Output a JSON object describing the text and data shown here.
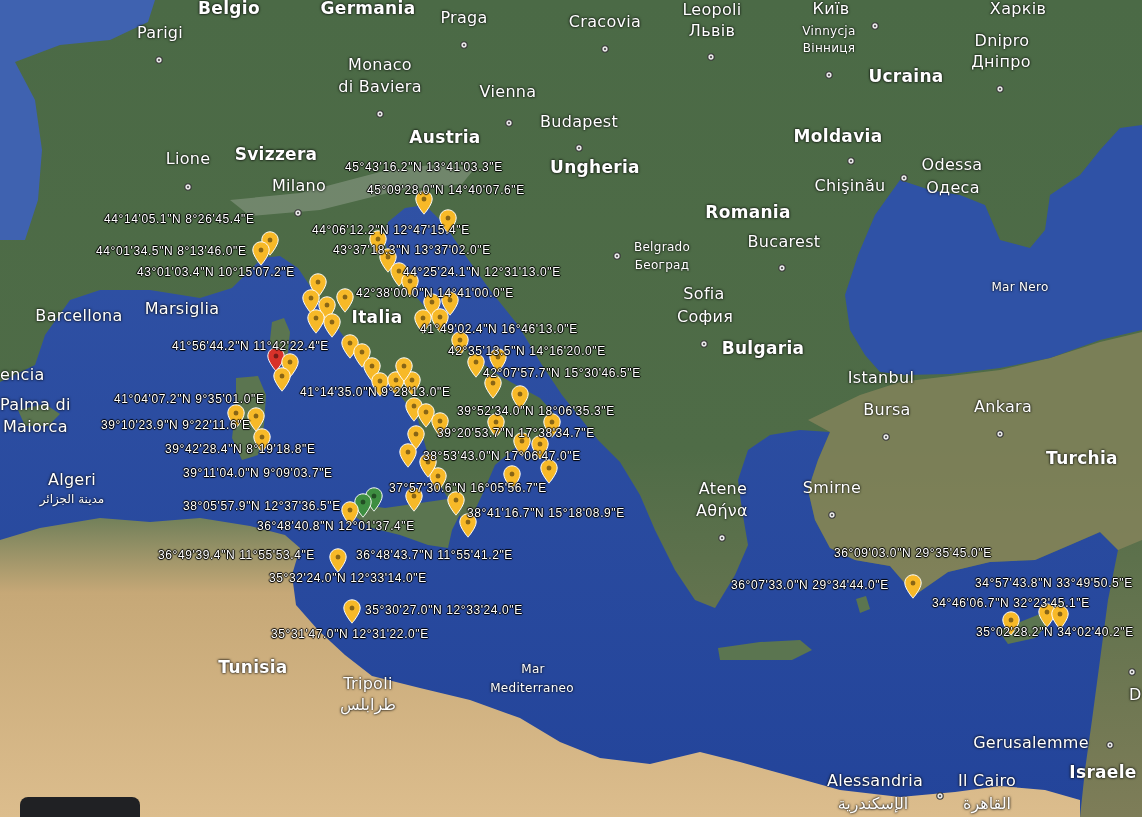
{
  "map": {
    "place_labels": [
      {
        "text": "Belgio",
        "kind": "country"
      },
      {
        "text": "Germania",
        "kind": "country"
      },
      {
        "text": "Praga",
        "kind": "city"
      },
      {
        "text": "Leopoli",
        "kind": "city"
      },
      {
        "text": "Київ",
        "kind": "city"
      },
      {
        "text": "Харків",
        "kind": "city"
      },
      {
        "text": "Cracovia",
        "kind": "city"
      },
      {
        "text": "Parigi",
        "kind": "city"
      },
      {
        "text": "Львів",
        "kind": "city"
      },
      {
        "text": "Vinnycja",
        "kind": "small-city"
      },
      {
        "text": "Вінниця",
        "kind": "small-city"
      },
      {
        "text": "Dnipro",
        "kind": "city"
      },
      {
        "text": "Monaco",
        "kind": "city"
      },
      {
        "text": "Дніпро",
        "kind": "city"
      },
      {
        "text": "di Baviera",
        "kind": "city"
      },
      {
        "text": "Vienna",
        "kind": "city"
      },
      {
        "text": "Ucraina",
        "kind": "country"
      },
      {
        "text": "Budapest",
        "kind": "city"
      },
      {
        "text": "Austria",
        "kind": "country"
      },
      {
        "text": "Moldavia",
        "kind": "country"
      },
      {
        "text": "Lione",
        "kind": "city"
      },
      {
        "text": "Svizzera",
        "kind": "country"
      },
      {
        "text": "Ungheria",
        "kind": "country"
      },
      {
        "text": "Odessa",
        "kind": "city"
      },
      {
        "text": "Milano",
        "kind": "city"
      },
      {
        "text": "Chişinău",
        "kind": "city"
      },
      {
        "text": "Одеса",
        "kind": "city"
      },
      {
        "text": "Romania",
        "kind": "country"
      },
      {
        "text": "Belgrado",
        "kind": "small-city"
      },
      {
        "text": "Bucarest",
        "kind": "city"
      },
      {
        "text": "Београд",
        "kind": "small-city"
      },
      {
        "text": "Sofia",
        "kind": "city"
      },
      {
        "text": "Mar Nero",
        "kind": "sea"
      },
      {
        "text": "Barcellona",
        "kind": "city"
      },
      {
        "text": "Marsiglia",
        "kind": "city"
      },
      {
        "text": "Italia",
        "kind": "country"
      },
      {
        "text": "София",
        "kind": "city"
      },
      {
        "text": "Bulgaria",
        "kind": "country"
      },
      {
        "text": "encia",
        "kind": "city"
      },
      {
        "text": "Istanbul",
        "kind": "city"
      },
      {
        "text": "Palma di",
        "kind": "city"
      },
      {
        "text": "Bursa",
        "kind": "city"
      },
      {
        "text": "Ankara",
        "kind": "city"
      },
      {
        "text": "Maiorca",
        "kind": "city"
      },
      {
        "text": "Turchia",
        "kind": "country"
      },
      {
        "text": "Algeri",
        "kind": "city"
      },
      {
        "text": "Atene",
        "kind": "city"
      },
      {
        "text": "Smirne",
        "kind": "city"
      },
      {
        "text": "مدينة الجزائر",
        "kind": "small-city"
      },
      {
        "text": "Αθήνα",
        "kind": "city"
      },
      {
        "text": "Tunisia",
        "kind": "country"
      },
      {
        "text": "Mar",
        "kind": "sea"
      },
      {
        "text": "Tripoli",
        "kind": "city"
      },
      {
        "text": "Mediterraneo",
        "kind": "sea"
      },
      {
        "text": "طرابلس",
        "kind": "city"
      },
      {
        "text": "D",
        "kind": "city"
      },
      {
        "text": "Gerusalemme",
        "kind": "city"
      },
      {
        "text": "Alessandria",
        "kind": "city"
      },
      {
        "text": "Il Cairo",
        "kind": "city"
      },
      {
        "text": "Israele",
        "kind": "country"
      },
      {
        "text": "الإسكندرية",
        "kind": "city"
      },
      {
        "text": "القاهرة",
        "kind": "city"
      }
    ],
    "coordinate_labels": [
      "45°43'16.2\"N 13°41'03.3\"E",
      "45°09'28.0\"N 14°40'07.6\"E",
      "44°14'05.1\"N 8°26'45.4\"E",
      "44°06'12.2\"N 12°47'15.4\"E",
      "44°01'34.5\"N 8°13'46.0\"E",
      "43°37'18.3\"N 13°37'02.0\"E",
      "43°01'03.4\"N 10°15'07.2\"E",
      "44°25'24.1\"N 12°31'13.0\"E",
      "42°38'00.0\"N 14°41'00.0\"E",
      "41°49'02.4\"N 16°46'13.0\"E",
      "41°56'44.2\"N 11°42'22.4\"E",
      "42°35'13.5\"N 14°16'20.0\"E",
      "42°07'57.7\"N 15°30'46.5\"E",
      "41°14'35.0\"N 9°28'13.0\"E",
      "41°04'07.2\"N 9°35'01.0\"E",
      "39°52'34.0\"N 18°06'35.3\"E",
      "39°10'23.9\"N 9°22'11.6\"E",
      "39°20'53.7\"N 17°38'34.7\"E",
      "39°42'28.4\"N 8°19'18.8\"E",
      "38°53'43.0\"N 17°06'47.0\"E",
      "39°11'04.0\"N 9°09'03.7\"E",
      "37°57'30.6\"N 16°05'56.7\"E",
      "38°05'57.9\"N 12°37'36.5\"E",
      "38°41'16.7\"N 15°18'08.9\"E",
      "36°48'40.8\"N 12°01'37.4\"E",
      "36°49'39.4\"N 11°55'53.4\"E",
      "36°48'43.7\"N 11°55'41.2\"E",
      "36°09'03.0\"N 29°35'45.0\"E",
      "35°32'24.0\"N 12°33'14.0\"E",
      "36°07'33.0\"N 29°34'44.0\"E",
      "34°57'43.8\"N 33°49'50.5\"E",
      "34°46'06.7\"N 32°23'45.1\"E",
      "35°30'27.0\"N 12°33'24.0\"E",
      "35°31'47.0\"N 12°31'22.0\"E",
      "35°02'28.2\"N 34°02'40.2\"E"
    ],
    "markers": [
      {
        "color": "#f7b928"
      },
      {
        "color": "#f7b928"
      },
      {
        "color": "#f7b928"
      },
      {
        "color": "#f7b928"
      },
      {
        "color": "#f7b928"
      },
      {
        "color": "#f7b928"
      },
      {
        "color": "#f7b928"
      },
      {
        "color": "#f7b928"
      },
      {
        "color": "#f7b928"
      },
      {
        "color": "#f7b928"
      },
      {
        "color": "#f7b928"
      },
      {
        "color": "#f7b928"
      },
      {
        "color": "#f7b928"
      },
      {
        "color": "#f7b928"
      },
      {
        "color": "#f7b928"
      },
      {
        "color": "#f7b928"
      },
      {
        "color": "#f7b928"
      },
      {
        "color": "#f7b928"
      },
      {
        "color": "#f7b928"
      },
      {
        "color": "#d7322a"
      },
      {
        "color": "#f7b928"
      },
      {
        "color": "#f7b928"
      },
      {
        "color": "#f7b928"
      },
      {
        "color": "#f7b928"
      },
      {
        "color": "#f7b928"
      },
      {
        "color": "#f7b928"
      },
      {
        "color": "#f7b928"
      },
      {
        "color": "#f7b928"
      },
      {
        "color": "#f7b928"
      },
      {
        "color": "#f7b928"
      },
      {
        "color": "#f7b928"
      },
      {
        "color": "#f7b928"
      },
      {
        "color": "#f7b928"
      },
      {
        "color": "#f7b928"
      },
      {
        "color": "#f7b928"
      },
      {
        "color": "#f7b928"
      },
      {
        "color": "#f7b928"
      },
      {
        "color": "#f7b928"
      },
      {
        "color": "#f7b928"
      },
      {
        "color": "#f7b928"
      },
      {
        "color": "#f7b928"
      },
      {
        "color": "#f7b928"
      },
      {
        "color": "#f7b928"
      },
      {
        "color": "#f7b928"
      },
      {
        "color": "#f7b928"
      },
      {
        "color": "#f7b928"
      },
      {
        "color": "#3e8e41"
      },
      {
        "color": "#3e8e41"
      },
      {
        "color": "#f7b928"
      },
      {
        "color": "#f7b928"
      },
      {
        "color": "#f7b928"
      },
      {
        "color": "#f7b928"
      },
      {
        "color": "#f7b928"
      },
      {
        "color": "#f7b928"
      },
      {
        "color": "#f7b928"
      },
      {
        "color": "#f7b928"
      },
      {
        "color": "#f7b928"
      },
      {
        "color": "#f7b928"
      },
      {
        "color": "#f7b928"
      },
      {
        "color": "#f7b928"
      },
      {
        "color": "#f7b928"
      }
    ]
  }
}
